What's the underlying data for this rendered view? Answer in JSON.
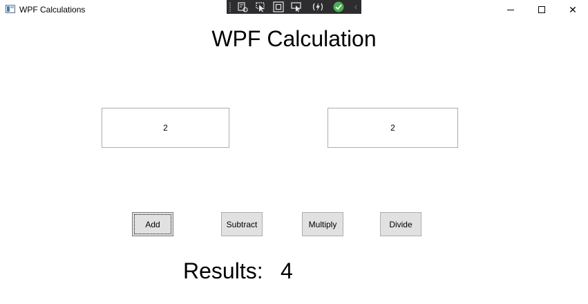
{
  "window": {
    "title": "WPF Calculations",
    "icon": "app-window-icon",
    "controls": {
      "minimize": "minimize-icon",
      "maximize": "maximize-icon",
      "close": "close-icon",
      "close_glyph": "✕"
    }
  },
  "debug_toolbar": {
    "tools": [
      "live-visual-tree-icon",
      "select-element-icon",
      "display-layout-adorners-icon",
      "track-focused-element-icon",
      "hot-reload-icon",
      "hot-reload-status-icon",
      "collapse-toolbar-icon"
    ],
    "status_color": "#4caf50",
    "collapse_glyph": "‹"
  },
  "main": {
    "heading": "WPF Calculation",
    "input1": "2",
    "input2": "2",
    "buttons": {
      "add": "Add",
      "subtract": "Subtract",
      "multiply": "Multiply",
      "divide": "Divide"
    },
    "results_label": "Results:",
    "results_value": "4"
  }
}
